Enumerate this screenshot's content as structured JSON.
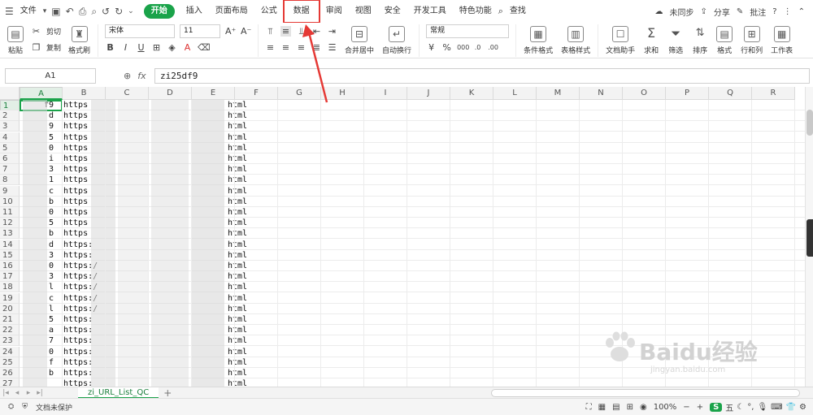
{
  "menubar": {
    "file_label": "文件",
    "tabs": [
      {
        "label": "开始",
        "active": true
      },
      {
        "label": "插入"
      },
      {
        "label": "页面布局"
      },
      {
        "label": "公式"
      },
      {
        "label": "数据",
        "highlight": true
      },
      {
        "label": "审阅"
      },
      {
        "label": "视图"
      },
      {
        "label": "安全"
      },
      {
        "label": "开发工具"
      },
      {
        "label": "特色功能"
      },
      {
        "label": "查找"
      }
    ],
    "sync_label": "未同步",
    "share_label": "分享",
    "comment_label": "批注",
    "help_label": "?"
  },
  "ribbon": {
    "paste_label": "粘贴",
    "cut_label": "剪切",
    "copy_label": "复制",
    "format_painter_label": "格式刷",
    "font_name": "宋体",
    "font_size": "11",
    "merge_label": "合并居中",
    "wrap_label": "自动换行",
    "number_format": "常规",
    "cond_format_label": "条件格式",
    "table_style_label": "表格样式",
    "doc_helper_label": "文档助手",
    "sum_label": "求和",
    "filter_label": "筛选",
    "sort_label": "排序",
    "format_label": "格式",
    "rowcol_label": "行和列",
    "sheet_label": "工作表"
  },
  "formulabar": {
    "name_box": "A1",
    "fx_label": "fx",
    "formula": "zi25df9"
  },
  "grid": {
    "columns": [
      "A",
      "B",
      "C",
      "D",
      "E",
      "F",
      "G",
      "H",
      "I",
      "J",
      "K",
      "L",
      "M",
      "N",
      "O",
      "P",
      "Q",
      "R"
    ],
    "rows": [
      {
        "n": "1",
        "a": "f9",
        "b": "https",
        "e": "html"
      },
      {
        "n": "2",
        "a": "d",
        "b": "https",
        "e": "html"
      },
      {
        "n": "3",
        "a": "9",
        "b": "https",
        "e": "html"
      },
      {
        "n": "4",
        "a": "5",
        "b": "https",
        "e": "html"
      },
      {
        "n": "5",
        "a": "0",
        "b": "https",
        "e": "html"
      },
      {
        "n": "6",
        "a": "i",
        "b": "https",
        "e": "html"
      },
      {
        "n": "7",
        "a": "3",
        "b": "https",
        "e": "html"
      },
      {
        "n": "8",
        "a": "1",
        "b": "https",
        "e": "html"
      },
      {
        "n": "9",
        "a": "c",
        "b": "https",
        "e": "html"
      },
      {
        "n": "10",
        "a": "b",
        "b": "https",
        "e": "html"
      },
      {
        "n": "11",
        "a": "0",
        "b": "https",
        "e": "html"
      },
      {
        "n": "12",
        "a": "5",
        "b": "https",
        "e": "html"
      },
      {
        "n": "13",
        "a": "b",
        "b": "https",
        "e": "html"
      },
      {
        "n": "14",
        "a": "d",
        "b": "https:",
        "e": "html"
      },
      {
        "n": "15",
        "a": "3",
        "b": "https:",
        "e": "html"
      },
      {
        "n": "16",
        "a": "0",
        "b": "https:/",
        "e": "html"
      },
      {
        "n": "17",
        "a": "3",
        "b": "https:/",
        "e": "html"
      },
      {
        "n": "18",
        "a": "l",
        "b": "https:/",
        "e": "html"
      },
      {
        "n": "19",
        "a": "c",
        "b": "https:/",
        "e": "html"
      },
      {
        "n": "20",
        "a": "l",
        "b": "https:/",
        "e": "html"
      },
      {
        "n": "21",
        "a": "5",
        "b": "https:",
        "e": "html"
      },
      {
        "n": "22",
        "a": "a",
        "b": "https:",
        "e": "html"
      },
      {
        "n": "23",
        "a": "7",
        "b": "https:",
        "e": "html"
      },
      {
        "n": "24",
        "a": "0",
        "b": "https:",
        "e": "html"
      },
      {
        "n": "25",
        "a": "f",
        "b": "https:",
        "e": "html"
      },
      {
        "n": "26",
        "a": "b",
        "b": "https:",
        "e": "html"
      },
      {
        "n": "27",
        "a": "",
        "b": "https:",
        "e": "html"
      }
    ]
  },
  "sheetbar": {
    "sheet_name": "zi_URL_List_QC"
  },
  "statusbar": {
    "doc_protect": "文档未保护",
    "zoom": "100%",
    "ime_label": "S",
    "ime_mode": "五"
  },
  "watermark": {
    "brand": "Baidu经验",
    "url": "jingyan.baidu.com"
  },
  "colors": {
    "accent": "#1aa34a",
    "annotation": "#e53935"
  }
}
